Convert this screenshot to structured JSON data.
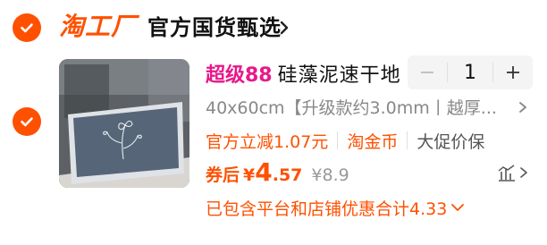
{
  "shop": {
    "logo": "淘工厂",
    "name": "官方国货甄选"
  },
  "item": {
    "tag": "超级88",
    "title": "硅藻泥速干地",
    "quantity": "1",
    "spec": "40x60cm【升级款约3.0mm丨越厚...",
    "promos": [
      "官方立减1.07元",
      "淘金币",
      "大促价保"
    ],
    "price": {
      "label": "券后",
      "currency": "¥",
      "integer": "4",
      "decimal": ".57",
      "original": "¥8.9"
    },
    "discount_summary": "已包含平台和店铺优惠合计4.33"
  },
  "colors": {
    "accent": "#ff5000",
    "tag": "#e8188a",
    "muted": "#888888"
  },
  "icons": {
    "shop_check": "check-circle-icon",
    "item_check": "check-circle-icon",
    "shop_arrow": "chevron-right-icon",
    "spec_more": "chevron-right-icon",
    "price_detail": "price-trend-icon",
    "discount_arrow": "chevron-down-icon"
  }
}
